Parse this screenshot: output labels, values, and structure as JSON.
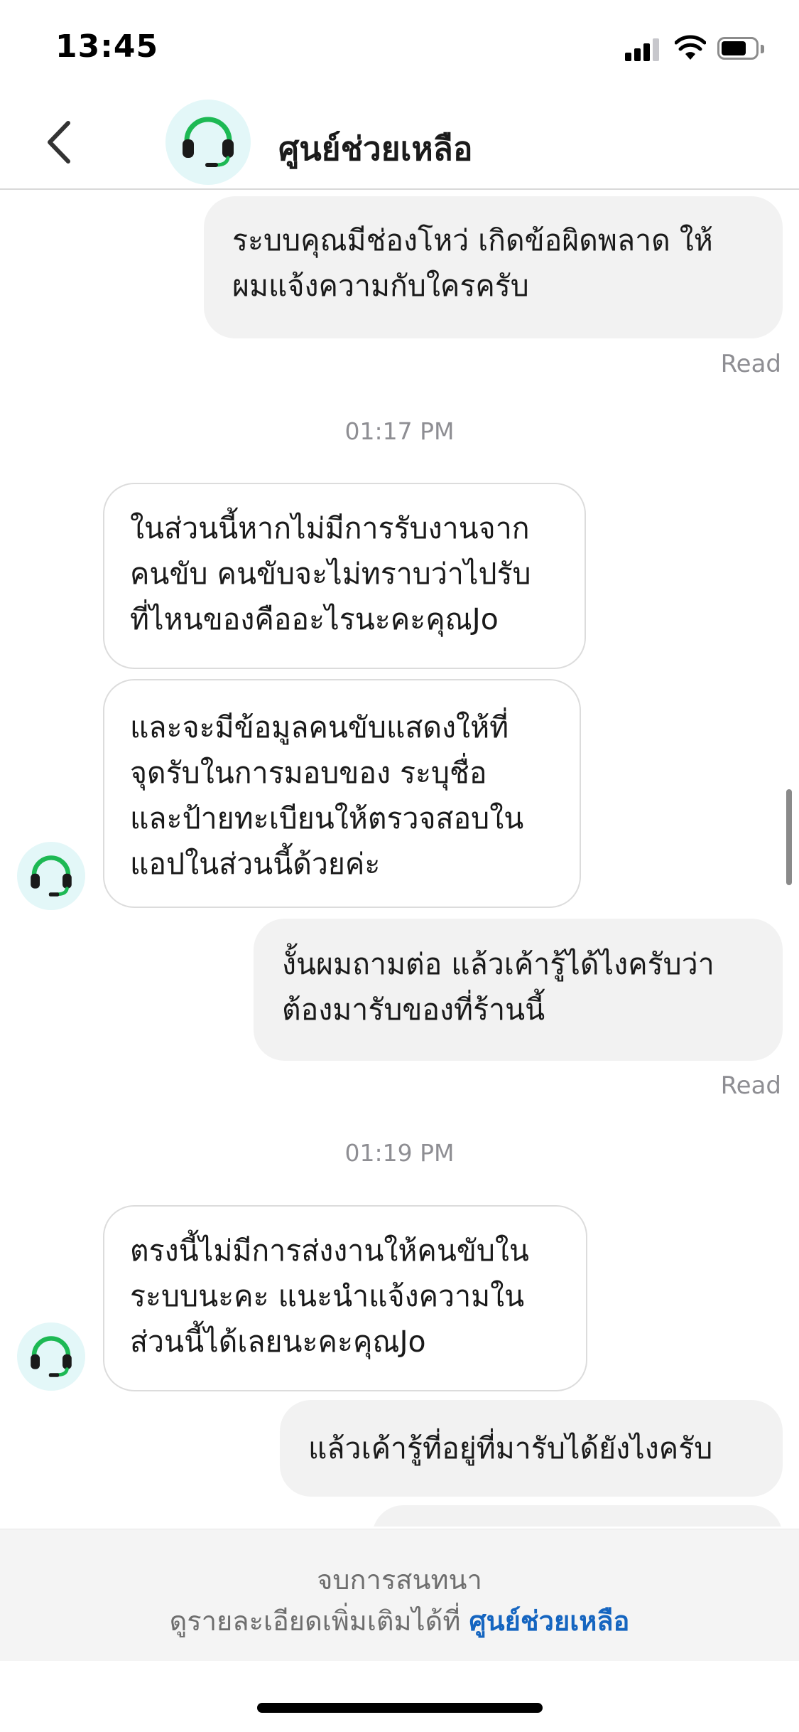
{
  "status": {
    "time": "13:45"
  },
  "header": {
    "title": "ศูนย์ช่วยเหลือ",
    "back_icon": "chevron-left-icon",
    "avatar_icon": "headset-icon"
  },
  "colors": {
    "accent_green": "#1db954",
    "link_blue": "#1565c0",
    "avatar_bg": "#e3f7f8",
    "outgoing_bubble": "#f2f2f2"
  },
  "messages": [
    {
      "dir": "out",
      "text": "ระบบคุณมีช่องโหว่ เกิดข้อผิดพลาด ให้\nผมแจ้งความกับใครครับ",
      "status": "Read"
    },
    {
      "type": "time",
      "text": "01:17 PM"
    },
    {
      "dir": "in",
      "text": "ในส่วนนี้หากไม่มีการรับงานจาก\nคนขับ คนขับจะไม่ทราบว่าไปรับ\nที่ไหนของคืออะไรนะคะคุณJo"
    },
    {
      "dir": "in",
      "text": "และจะมีข้อมูลคนขับแสดงให้ที่\nจุดรับในการมอบของ ระบุชื่อ\nและป้ายทะเบียนให้ตรวจสอบใน\nแอปในส่วนนี้ด้วยค่ะ"
    },
    {
      "dir": "out",
      "text": "งั้นผมถามต่อ แล้วเค้ารู้ได้ไงครับว่า\nต้องมารับของที่ร้านนี้",
      "status": "Read"
    },
    {
      "type": "time",
      "text": "01:19 PM"
    },
    {
      "dir": "in",
      "text": "ตรงนี้ไม่มีการส่งงานให้คนขับใน\nระบบนะคะ แนะนำแจ้งความใน\nส่วนนี้ได้เลยนะคะคุณJo"
    },
    {
      "dir": "out",
      "text": "แล้วเค้ารู้ที่อยู่ที่มารับได้ยังไงครับ"
    }
  ],
  "footer": {
    "ended": "จบการสนทนา",
    "more_prefix": "ดูรายละเอียดเพิ่มเติมได้ที่ ",
    "more_link": "ศูนย์ช่วยเหลือ"
  }
}
